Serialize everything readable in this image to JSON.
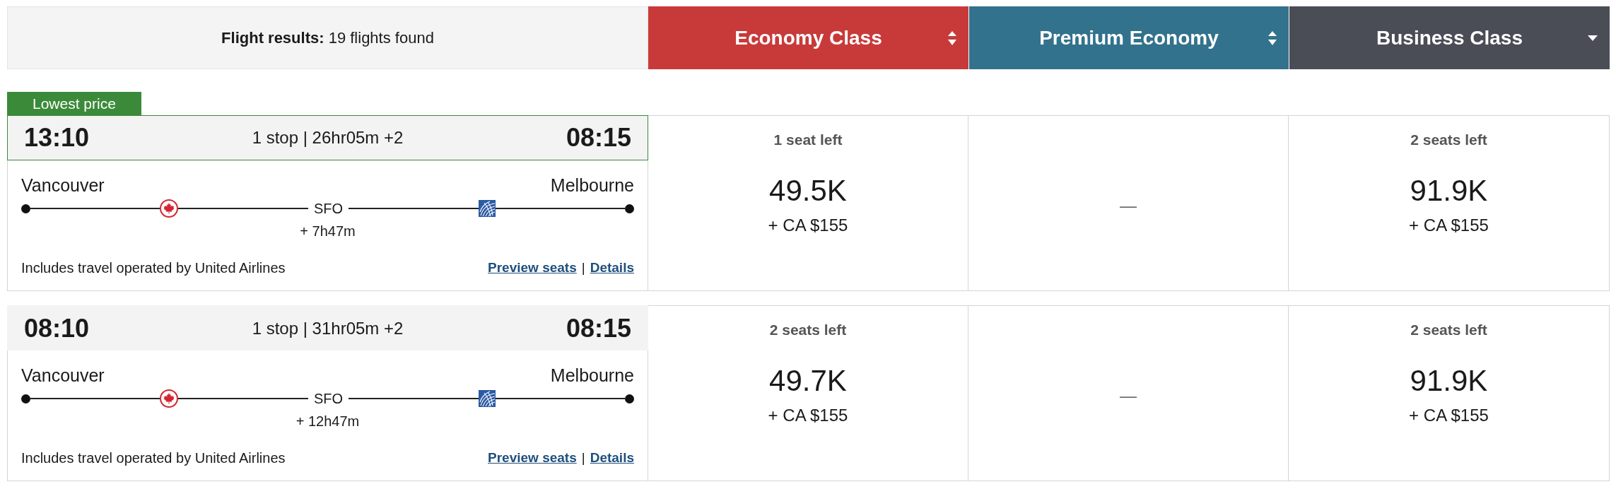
{
  "header": {
    "summary": "**Flight results:** 19 flights found"
  },
  "cabins": [
    {
      "label": "Economy Class",
      "color": "#c83a3a",
      "sorted": false
    },
    {
      "label": "Premium Economy",
      "color": "#33728c",
      "sorted": false
    },
    {
      "label": "Business Class",
      "color": "#4a4c56",
      "sorted": true
    }
  ],
  "flights": [
    {
      "badge": "Lowest price",
      "highlighted": true,
      "depart": "13:10",
      "summary": "1 stop | 26hr05m +2",
      "arrive": "08:15",
      "origin": "Vancouver",
      "destination": "Melbourne",
      "stop": "SFO",
      "layover": "+ 7h47m",
      "note": "Includes travel operated by United Airlines",
      "links": [
        "Preview seats",
        "Details"
      ],
      "separator": "|",
      "fares": [
        {
          "kind": "available",
          "seats": "1 seat left",
          "points": "49.5K",
          "taxes": "+ CA $155"
        },
        {
          "kind": "unavailable",
          "text": "—"
        },
        {
          "kind": "available",
          "seats": "2 seats left",
          "points": "91.9K",
          "taxes": "+ CA $155"
        }
      ]
    },
    {
      "highlighted": false,
      "depart": "08:10",
      "summary": "1 stop | 31hr05m +2",
      "arrive": "08:15",
      "origin": "Vancouver",
      "destination": "Melbourne",
      "stop": "SFO",
      "layover": "+ 12h47m",
      "note": "Includes travel operated by United Airlines",
      "links": [
        "Preview seats",
        "Details"
      ],
      "separator": "|",
      "fares": [
        {
          "kind": "available",
          "seats": "2 seats left",
          "points": "49.7K",
          "taxes": "+ CA $155"
        },
        {
          "kind": "unavailable",
          "text": "—"
        },
        {
          "kind": "available",
          "seats": "2 seats left",
          "points": "91.9K",
          "taxes": "+ CA $155"
        }
      ]
    }
  ]
}
